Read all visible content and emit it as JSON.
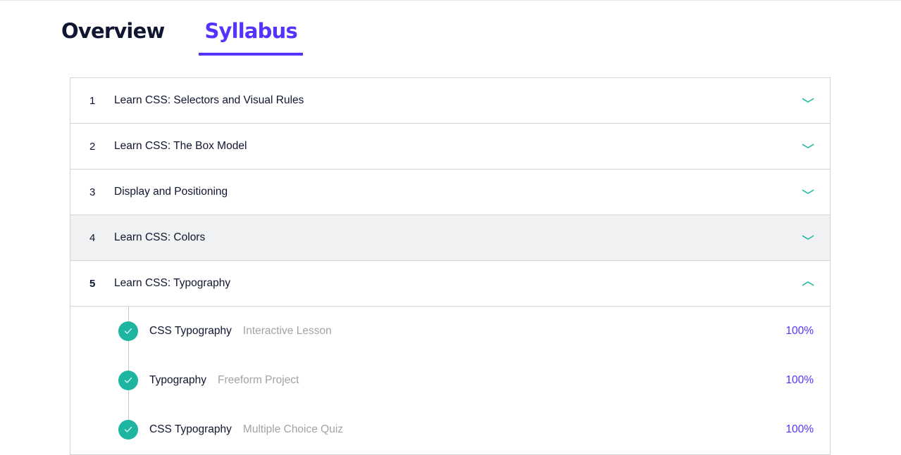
{
  "tabs": {
    "overview": "Overview",
    "syllabus": "Syllabus",
    "active": "syllabus"
  },
  "colors": {
    "accent": "#5533ff",
    "check": "#1eb5a0",
    "chevron": "#1eb5a0",
    "hover_row": "#f0f1f3"
  },
  "modules": [
    {
      "num": "1",
      "title": "Learn CSS: Selectors and Visual Rules",
      "expanded": false,
      "icon": "chevron-down-icon"
    },
    {
      "num": "2",
      "title": "Learn CSS: The Box Model",
      "expanded": false,
      "icon": "chevron-down-icon"
    },
    {
      "num": "3",
      "title": "Display and Positioning",
      "expanded": false,
      "icon": "chevron-down-icon"
    },
    {
      "num": "4",
      "title": "Learn CSS: Colors",
      "expanded": false,
      "hovered": true,
      "icon": "chevron-down-icon"
    },
    {
      "num": "5",
      "title": "Learn CSS: Typography",
      "expanded": true,
      "icon": "chevron-up-icon"
    }
  ],
  "lessons": [
    {
      "name": "CSS Typography",
      "type": "Interactive Lesson",
      "progress": "100%",
      "complete": true,
      "icon": "check-circle-icon"
    },
    {
      "name": "Typography",
      "type": "Freeform Project",
      "progress": "100%",
      "complete": true,
      "icon": "check-circle-icon"
    },
    {
      "name": "CSS Typography",
      "type": "Multiple Choice Quiz",
      "progress": "100%",
      "complete": true,
      "icon": "check-circle-icon"
    }
  ]
}
